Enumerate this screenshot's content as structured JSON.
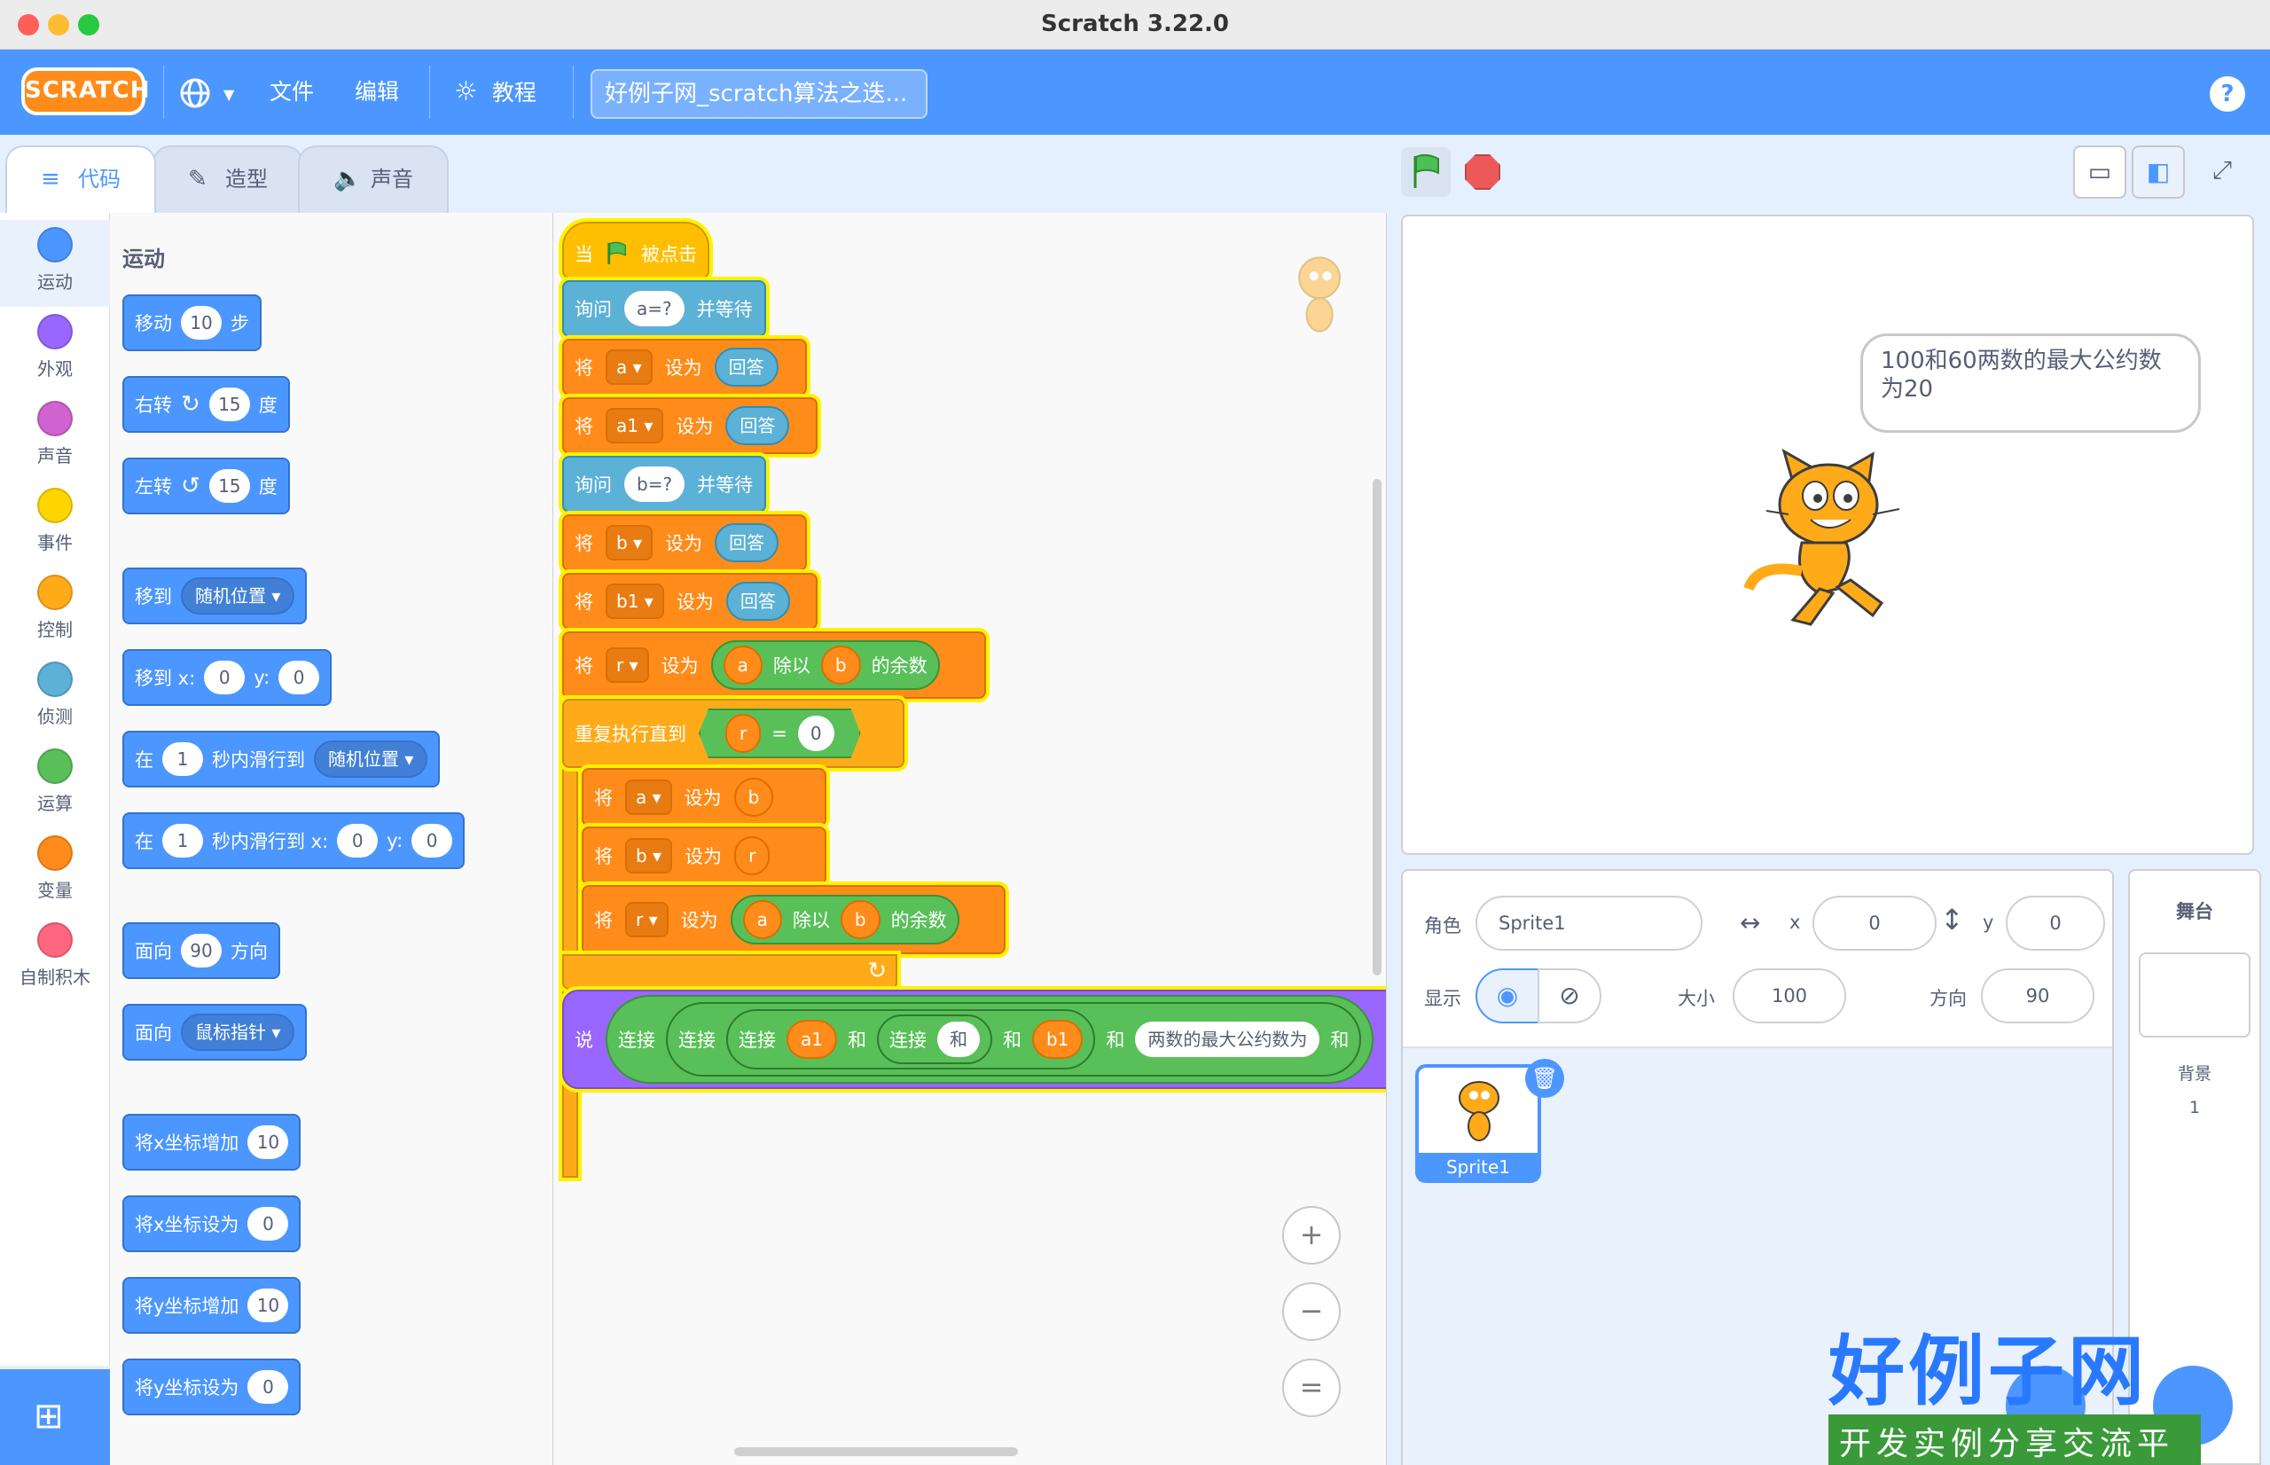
{
  "window": {
    "title": "Scratch 3.22.0"
  },
  "menubar": {
    "logo": "SCRATCH",
    "file": "文件",
    "edit": "编辑",
    "tutorials": "教程",
    "project_title": "好例子网_scratch算法之迭...",
    "help": "?"
  },
  "tabs": {
    "code": "代码",
    "costumes": "造型",
    "sounds": "声音"
  },
  "categories": [
    {
      "label": "运动",
      "color": "#4c97ff"
    },
    {
      "label": "外观",
      "color": "#9966ff"
    },
    {
      "label": "声音",
      "color": "#cf63cf"
    },
    {
      "label": "事件",
      "color": "#ffd500"
    },
    {
      "label": "控制",
      "color": "#ffab19"
    },
    {
      "label": "侦测",
      "color": "#5cb1d6"
    },
    {
      "label": "运算",
      "color": "#59c059"
    },
    {
      "label": "变量",
      "color": "#ff8c1a"
    },
    {
      "label": "自制积木",
      "color": "#ff6680"
    }
  ],
  "palette": {
    "heading": "运动",
    "move": {
      "a": "移动",
      "v": "10",
      "b": "步"
    },
    "turn_right": {
      "a": "右转",
      "v": "15",
      "b": "度"
    },
    "turn_left": {
      "a": "左转",
      "v": "15",
      "b": "度"
    },
    "goto_random": {
      "a": "移到",
      "dd": "随机位置"
    },
    "goto_xy": {
      "a": "移到 x:",
      "x": "0",
      "b": "y:",
      "y": "0"
    },
    "glide_random": {
      "a": "在",
      "v": "1",
      "b": "秒内滑行到",
      "dd": "随机位置"
    },
    "glide_xy": {
      "a": "在",
      "v": "1",
      "b": "秒内滑行到 x:",
      "x": "0",
      "c": "y:",
      "y": "0"
    },
    "point_dir": {
      "a": "面向",
      "v": "90",
      "b": "方向"
    },
    "point_towards": {
      "a": "面向",
      "dd": "鼠标指针"
    },
    "change_x": {
      "a": "将x坐标增加",
      "v": "10"
    },
    "set_x": {
      "a": "将x坐标设为",
      "v": "0"
    },
    "change_y": {
      "a": "将y坐标增加",
      "v": "10"
    },
    "set_y": {
      "a": "将y坐标设为",
      "v": "0"
    }
  },
  "script": {
    "hat": {
      "a": "当",
      "b": "被点击"
    },
    "ask_a": {
      "a": "询问",
      "v": "a=?",
      "b": "并等待"
    },
    "set_a": {
      "a": "将",
      "var": "a",
      "b": "设为",
      "val": "回答"
    },
    "set_a1": {
      "a": "将",
      "var": "a1",
      "b": "设为",
      "val": "回答"
    },
    "ask_b": {
      "a": "询问",
      "v": "b=?",
      "b": "并等待"
    },
    "set_b": {
      "a": "将",
      "var": "b",
      "b": "设为",
      "val": "回答"
    },
    "set_b1": {
      "a": "将",
      "var": "b1",
      "b": "设为",
      "val": "回答"
    },
    "set_r": {
      "a": "将",
      "var": "r",
      "b": "设为",
      "x": "a",
      "op": "除以",
      "y": "b",
      "c": "的余数"
    },
    "repeat_until": {
      "a": "重复执行直到",
      "x": "r",
      "op": "=",
      "y": "0"
    },
    "in_set_a": {
      "a": "将",
      "var": "a",
      "b": "设为",
      "val": "b"
    },
    "in_set_b": {
      "a": "将",
      "var": "b",
      "b": "设为",
      "val": "r"
    },
    "in_set_r": {
      "a": "将",
      "var": "r",
      "b": "设为",
      "x": "a",
      "op": "除以",
      "y": "b",
      "c": "的余数"
    },
    "loop_arrow": "↻",
    "say": {
      "a": "说",
      "j1": "连接",
      "j2": "连接",
      "j3": "连接",
      "v1": "a1",
      "t1": "和",
      "j4": "连接",
      "t2": "和",
      "t3": "和",
      "v2": "b1",
      "t4": "和",
      "t5": "两数的最大公约数为",
      "t6": "和"
    }
  },
  "zoom": {
    "in": "+",
    "out": "−",
    "reset": "="
  },
  "stage": {
    "bubble": "100和60两数的最大公约数为20"
  },
  "sprite_info": {
    "sprite_label": "角色",
    "sprite_name": "Sprite1",
    "x_label": "x",
    "x": "0",
    "y_label": "y",
    "y": "0",
    "show_label": "显示",
    "size_label": "大小",
    "size": "100",
    "direction_label": "方向",
    "direction": "90"
  },
  "sprites": [
    {
      "name": "Sprite1"
    }
  ],
  "stage_pane": {
    "title": "舞台",
    "backdrops_label": "背景",
    "backdrops_count": "1"
  },
  "watermark": {
    "title": "好例子网",
    "subtitle": "开发实例分享交流平台"
  }
}
